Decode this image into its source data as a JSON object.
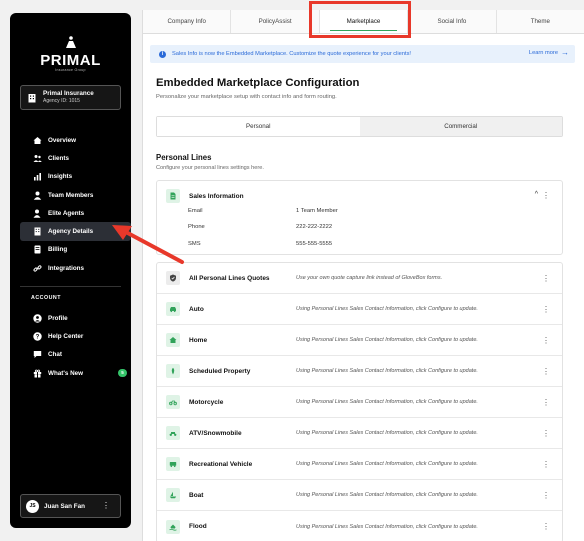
{
  "brand": {
    "name": "PRIMAL",
    "subtitle": "Insurance Group"
  },
  "agency": {
    "name": "Primal Insurance",
    "id": "Agency ID: 1015"
  },
  "sidebar": {
    "items": [
      {
        "label": "Overview",
        "icon": "home-icon"
      },
      {
        "label": "Clients",
        "icon": "users-icon"
      },
      {
        "label": "Insights",
        "icon": "bar-chart-icon"
      },
      {
        "label": "Team Members",
        "icon": "person-icon"
      },
      {
        "label": "Elite Agents",
        "icon": "person-star-icon"
      },
      {
        "label": "Agency Details",
        "icon": "building-icon",
        "active": true
      },
      {
        "label": "Billing",
        "icon": "billing-icon"
      },
      {
        "label": "Integrations",
        "icon": "link-icon"
      }
    ],
    "account_heading": "ACCOUNT",
    "account_items": [
      {
        "label": "Profile",
        "icon": "profile-icon"
      },
      {
        "label": "Help Center",
        "icon": "help-icon"
      },
      {
        "label": "Chat",
        "icon": "chat-icon"
      },
      {
        "label": "What's New",
        "icon": "gift-icon",
        "badge": "5"
      }
    ]
  },
  "user": {
    "initials": "JS",
    "name": "Juan San Fan",
    "menu": "⋮"
  },
  "tabs": [
    "Company Info",
    "PolicyAssist",
    "Marketplace",
    "Social Info",
    "Theme"
  ],
  "banner": {
    "text": "Sales Info is now the Embedded Marketplace. Customize the quote experience for your clients!",
    "link": "Learn more"
  },
  "page": {
    "title": "Embedded Marketplace Configuration",
    "subtitle": "Personalize your marketplace setup with contact info and form routing."
  },
  "segment": {
    "personal": "Personal",
    "commercial": "Commercial"
  },
  "section": {
    "title": "Personal Lines",
    "subtitle": "Configure your personal lines settings here."
  },
  "sales_info": {
    "title": "Sales Information",
    "rows": [
      {
        "key": "Email",
        "value": "1 Team Member"
      },
      {
        "key": "Phone",
        "value": "222-222-2222"
      },
      {
        "key": "SMS",
        "value": "555-555-5555"
      }
    ]
  },
  "lines": [
    {
      "name": "All Personal Lines Quotes",
      "desc": "Use your own quote capture link instead of GloveBox forms.",
      "icon": "shield-icon"
    },
    {
      "name": "Auto",
      "desc": "Using Personal Lines Sales Contact Information, click Configure to update.",
      "icon": "car-icon"
    },
    {
      "name": "Home",
      "desc": "Using Personal Lines Sales Contact Information, click Configure to update.",
      "icon": "house-icon"
    },
    {
      "name": "Scheduled Property",
      "desc": "Using Personal Lines Sales Contact Information, click Configure to update.",
      "icon": "gem-icon"
    },
    {
      "name": "Motorcycle",
      "desc": "Using Personal Lines Sales Contact Information, click Configure to update.",
      "icon": "motorcycle-icon"
    },
    {
      "name": "ATV/Snowmobile",
      "desc": "Using Personal Lines Sales Contact Information, click Configure to update.",
      "icon": "atv-icon"
    },
    {
      "name": "Recreational Vehicle",
      "desc": "Using Personal Lines Sales Contact Information, click Configure to update.",
      "icon": "rv-icon"
    },
    {
      "name": "Boat",
      "desc": "Using Personal Lines Sales Contact Information, click Configure to update.",
      "icon": "boat-icon"
    },
    {
      "name": "Flood",
      "desc": "Using Personal Lines Sales Contact Information, click Configure to update.",
      "icon": "flood-icon"
    }
  ],
  "colors": {
    "accent_green": "#31a35a",
    "highlight_red": "#e8382a",
    "link_blue": "#2a6ad8"
  }
}
